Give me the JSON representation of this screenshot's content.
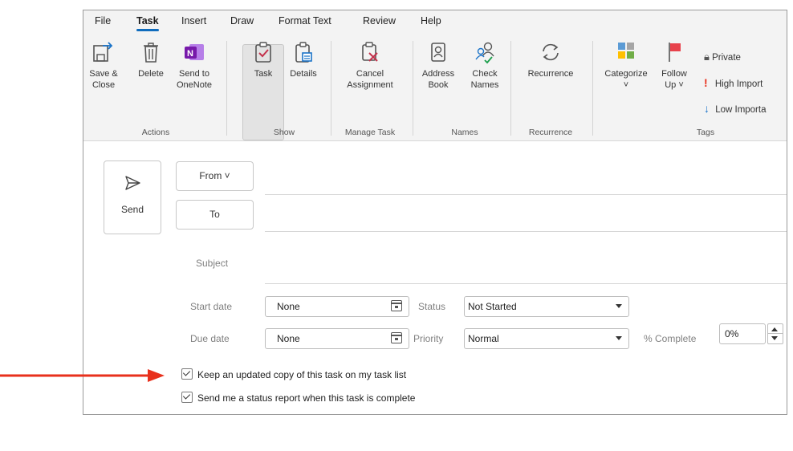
{
  "menu": [
    "File",
    "Task",
    "Insert",
    "Draw",
    "Format Text",
    "Review",
    "Help"
  ],
  "ribbon": {
    "actions": {
      "save_close": [
        "Save &",
        "Close"
      ],
      "delete": "Delete",
      "send_onenote": [
        "Send to",
        "OneNote"
      ],
      "label": "Actions"
    },
    "show": {
      "task": "Task",
      "details": "Details",
      "label": "Show"
    },
    "manage": {
      "cancel": [
        "Cancel",
        "Assignment"
      ],
      "label": "Manage Task"
    },
    "names": {
      "address_book": [
        "Address",
        "Book"
      ],
      "check_names": [
        "Check",
        "Names"
      ],
      "label": "Names"
    },
    "recurrence": {
      "recurrence": "Recurrence",
      "label": "Recurrence"
    },
    "tags": {
      "categorize": "Categorize",
      "follow_up": [
        "Follow",
        "Up ˅"
      ],
      "private": "Private",
      "high": "High Import",
      "low": "Low Importa",
      "label": "Tags"
    }
  },
  "compose": {
    "send": "Send",
    "from": "From ˅",
    "to": "To",
    "subject_label": "Subject"
  },
  "task_fields": {
    "start_date_label": "Start date",
    "start_date": "None",
    "due_date_label": "Due date",
    "due_date": "None",
    "status_label": "Status",
    "status": "Not Started",
    "priority_label": "Priority",
    "priority": "Normal",
    "complete_label": "% Complete",
    "complete": "0%"
  },
  "checkboxes": {
    "keep_copy": "Keep an updated copy of this task on my task list",
    "status_report": "Send me a status report when this task is complete"
  },
  "colors": {
    "accent": "#0f6cbd",
    "arrow": "#e8301c"
  }
}
